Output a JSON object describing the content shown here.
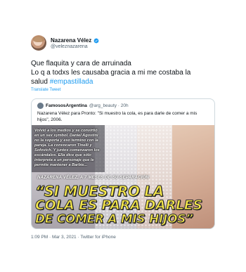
{
  "author": {
    "display_name": "Nazarena Vélez",
    "username": "@veleznazarena",
    "verified": true
  },
  "tweet": {
    "line1": "Que flaquita y cara de arruinada",
    "line2": "Lo q a todxs les causaba gracia a mi me costaba la",
    "line3_prefix": "salud ",
    "hashtag": "#empastillada",
    "translate_label": "Translate Tweet"
  },
  "quoted": {
    "display_name": "FamososArgentina",
    "handle_time": "@arg_beauty · 20h",
    "text": "Nazarena Vélez para Pronto: \"Si muestro la cola, es para darle de comer a mis hijos\", 2006.",
    "image": {
      "side_text": "Volvió a los medios y se convirtió en un sex symbol. Daniel Agostini no la soporta y eso termino con la pareja. La convocaron Tinelli y Sofovich. Y juntos comenzaron los escándalos. Ella dice que sólo interpreta a un personaje que le permite mantener a Barbie...",
      "caption": "NAZARENA VÉLEZ, A 7 MESES DE SU SEPARACIÓN",
      "headline_1": "“SI MUESTRO LA",
      "headline_2": "COLA ES PARA DARLES",
      "headline_3": "DE COMER A MIS HIJOS”"
    }
  },
  "meta": {
    "timestamp": "1:09 PM · Mar 3, 2021 · Twitter for iPhone"
  },
  "colors": {
    "link": "#1d9bf0",
    "text": "#0f1419",
    "secondary": "#536471",
    "verified": "#1d9bf0",
    "headline": "#f6e84a"
  }
}
